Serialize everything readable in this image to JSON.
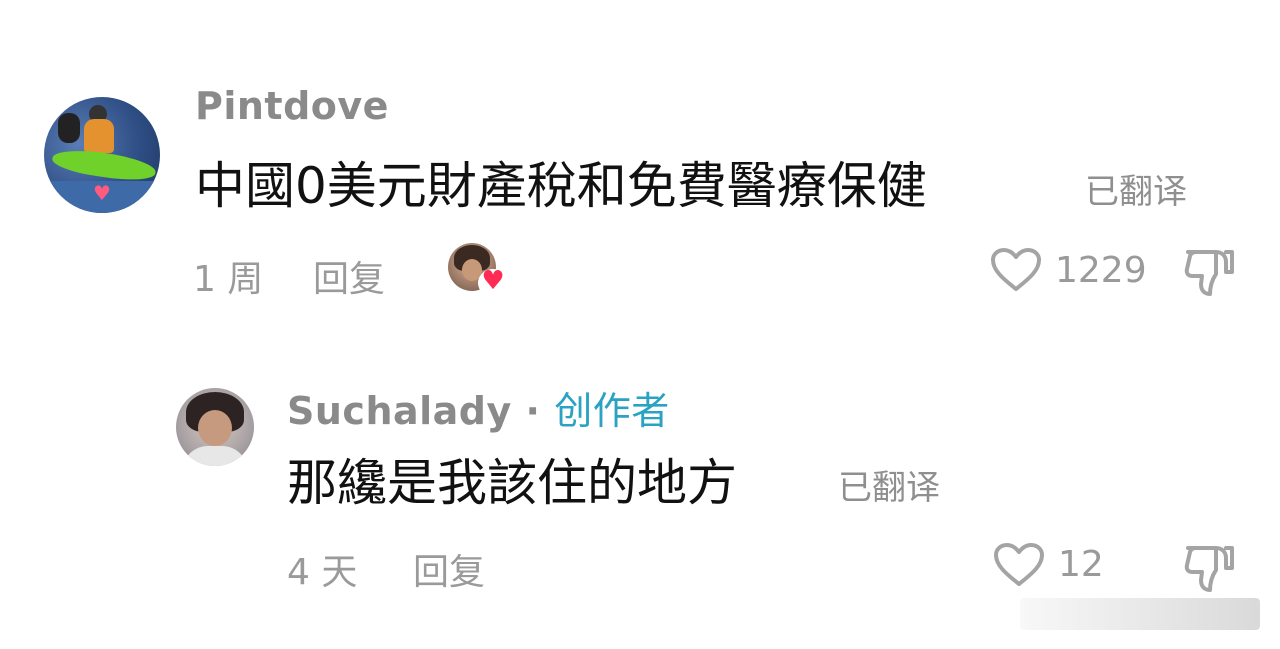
{
  "comment": {
    "username": "Pintdove",
    "text": "中國0美元財產稅和免費醫療保健",
    "translated_label": "已翻译",
    "time": "1 周",
    "reply_label": "回复",
    "like_count": "1229"
  },
  "reply": {
    "username": "Suchalady",
    "separator": "·",
    "creator_label": "创作者",
    "text": "那纔是我該住的地方",
    "translated_label": "已翻译",
    "time": "4 天",
    "reply_label": "回复",
    "like_count": "12"
  },
  "colors": {
    "accent_creator": "#2aa3c3",
    "heart_red": "#fe2c55",
    "meta_gray": "#9a9a9a"
  },
  "icons": [
    "heart-outline-icon",
    "thumbs-down-icon",
    "heart-filled-icon"
  ]
}
